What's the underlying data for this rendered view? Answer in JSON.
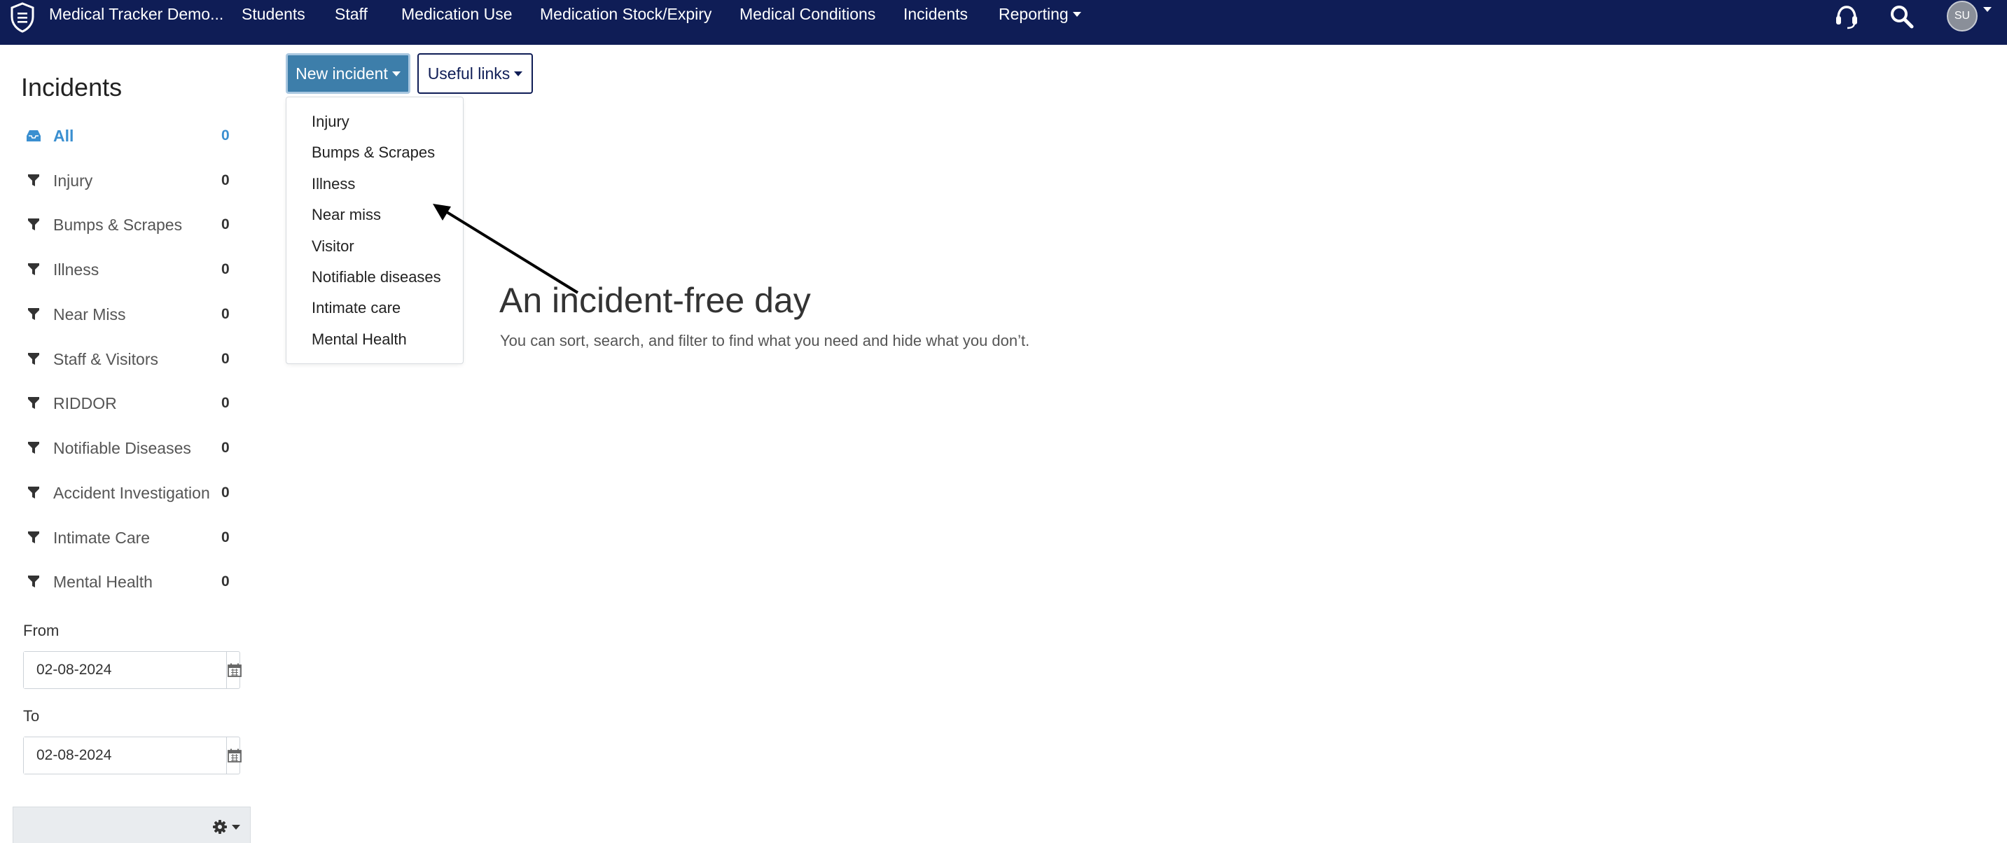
{
  "navbar": {
    "brand": "Medical Tracker Demo...",
    "links": [
      "Students",
      "Staff",
      "Medication Use",
      "Medication Stock/Expiry",
      "Medical Conditions",
      "Incidents"
    ],
    "reporting": "Reporting",
    "avatar_initials": "SU"
  },
  "sidebar": {
    "title": "Incidents",
    "items": [
      {
        "label": "All",
        "count": "0"
      },
      {
        "label": "Injury",
        "count": "0"
      },
      {
        "label": "Bumps & Scrapes",
        "count": "0"
      },
      {
        "label": "Illness",
        "count": "0"
      },
      {
        "label": "Near Miss",
        "count": "0"
      },
      {
        "label": "Staff & Visitors",
        "count": "0"
      },
      {
        "label": "RIDDOR",
        "count": "0"
      },
      {
        "label": "Notifiable Diseases",
        "count": "0"
      },
      {
        "label": "Accident Investigation",
        "count": "0"
      },
      {
        "label": "Intimate Care",
        "count": "0"
      },
      {
        "label": "Mental Health",
        "count": "0"
      }
    ],
    "from_label": "From",
    "from_value": "02-08-2024",
    "to_label": "To",
    "to_value": "02-08-2024"
  },
  "toolbar": {
    "new_incident": "New incident",
    "useful_links": "Useful links"
  },
  "dropdown": {
    "items": [
      "Injury",
      "Bumps & Scrapes",
      "Illness",
      "Near miss",
      "Visitor",
      "Notifiable diseases",
      "Intimate care",
      "Mental Health"
    ]
  },
  "empty_state": {
    "title": "An incident-free day",
    "subtitle": "You can sort, search, and filter to find what you need and hide what you don’t."
  },
  "colors": {
    "navbar": "#0f1d56",
    "primary_button": "#3d7eaa",
    "active_link": "#3a8fd0"
  },
  "icons": {
    "logo": "shield-list-icon",
    "support": "headset-icon",
    "search": "search-icon",
    "filter": "funnel-icon",
    "all": "inbox-icon",
    "calendar": "calendar-icon",
    "settings": "gear-icon"
  }
}
